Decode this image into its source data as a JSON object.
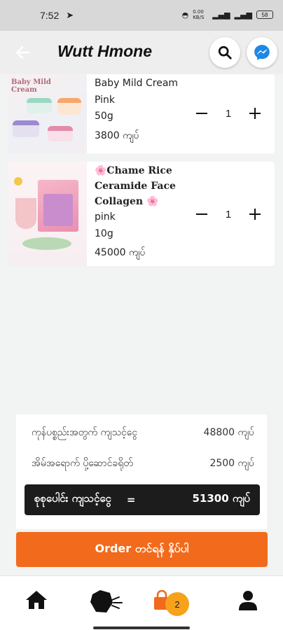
{
  "status_bar": {
    "time": "7:52",
    "net_speed": "0.00 KB/S",
    "battery": "58"
  },
  "app_bar": {
    "title": "Wutt Hmone"
  },
  "cart_items": [
    {
      "name": "Baby Mild Cream",
      "color": "Pink",
      "size": "50g",
      "price": "3800 ကျပ်",
      "quantity": "1",
      "image_label": "Baby Mild Cream"
    },
    {
      "name_line1": "🌸Chame Rice",
      "name_line2": "Ceramide Face",
      "name_line3": "Collagen 🌸",
      "color": "pink",
      "size": "10g",
      "price": "45000 ကျပ်",
      "quantity": "1"
    }
  ],
  "summary": {
    "subtotal_label": "ကုန်ပစ္စည်းအတွက် ကျသင့်ငွေ",
    "subtotal_value": "48800 ကျပ်",
    "delivery_label": "အိမ်အရောက် ပို့ဆောင်ခရိုတ်",
    "delivery_value": "2500 ကျပ်",
    "total_label": "စုစုပေါင်း ကျသင့်ငွေ",
    "total_eq": "=",
    "total_value": "51300 ကျပ်"
  },
  "order_button": {
    "label": "Order တင်ရန် နှိပ်ပါ"
  },
  "bottom_nav": {
    "cart_badge": "2"
  },
  "colors": {
    "accent": "#f26a1b",
    "badge": "#f7a21b",
    "total_bar": "#1c1c1c",
    "messenger": "#1e88e5"
  }
}
